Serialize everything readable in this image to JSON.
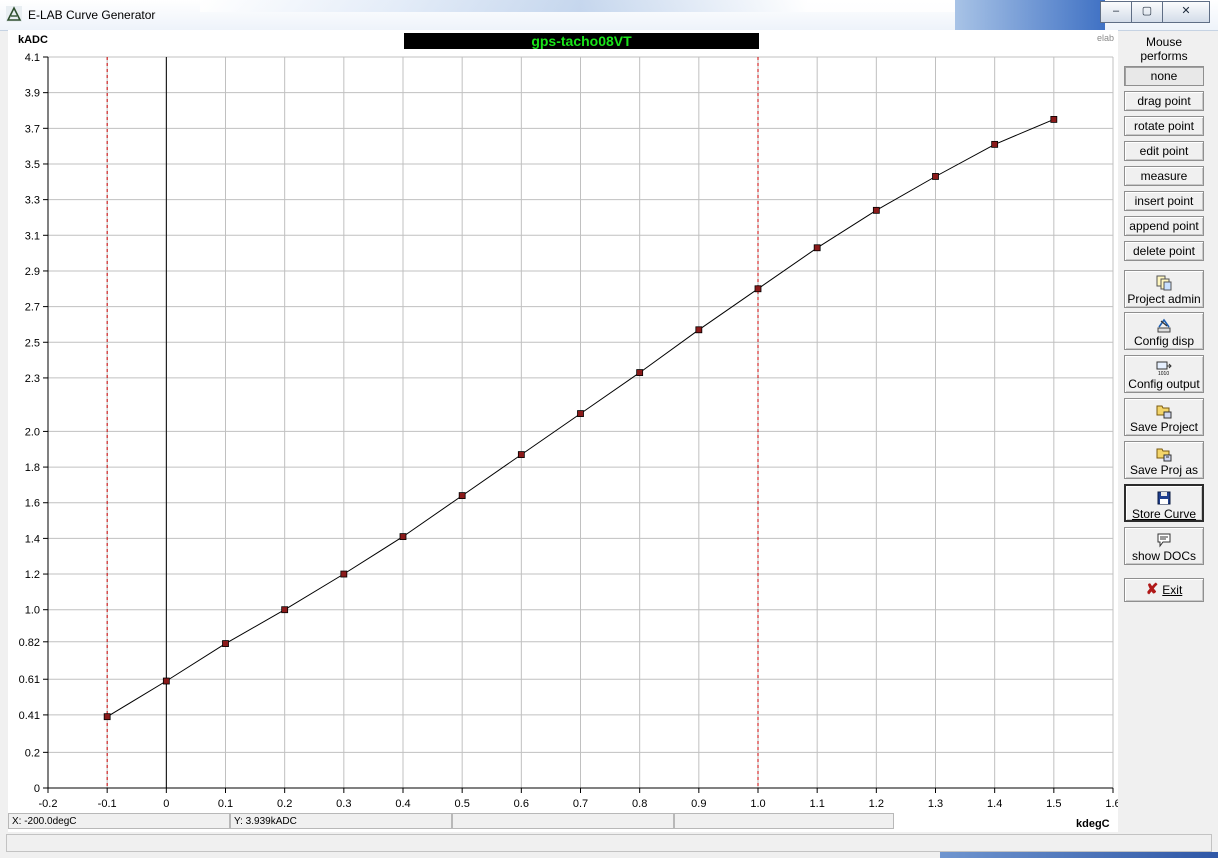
{
  "window": {
    "title": "E-LAB Curve Generator",
    "controls": {
      "minimize": "–",
      "maximize": "▢",
      "close": "✕"
    }
  },
  "plot": {
    "curve_name": "gps-tacho08VT",
    "watermark": "elab",
    "y_unit": "kADC",
    "x_unit": "kdegC",
    "x_ticks": [
      "-0.2",
      "-0.1",
      "0",
      "0.1",
      "0.2",
      "0.3",
      "0.4",
      "0.5",
      "0.6",
      "0.7",
      "0.8",
      "0.9",
      "1.0",
      "1.1",
      "1.2",
      "1.3",
      "1.4",
      "1.5",
      "1.6"
    ],
    "y_ticks": [
      "0",
      "0.2",
      "0.41",
      "0.61",
      "0.82",
      "1.0",
      "1.2",
      "1.4",
      "1.6",
      "1.8",
      "2.0",
      "2.3",
      "2.5",
      "2.7",
      "2.9",
      "3.1",
      "3.3",
      "3.5",
      "3.7",
      "3.9",
      "4.1"
    ],
    "x_range": [
      -0.2,
      1.6
    ],
    "y_range": [
      0,
      4.1
    ],
    "red_marker_x": [
      -0.1,
      1.0
    ],
    "zero_line_x": 0,
    "points": [
      [
        -0.1,
        0.4
      ],
      [
        0,
        0.6
      ],
      [
        0.1,
        0.81
      ],
      [
        0.2,
        1.0
      ],
      [
        0.3,
        1.2
      ],
      [
        0.4,
        1.41
      ],
      [
        0.5,
        1.64
      ],
      [
        0.6,
        1.87
      ],
      [
        0.7,
        2.1
      ],
      [
        0.8,
        2.33
      ],
      [
        0.9,
        2.57
      ],
      [
        1.0,
        2.8
      ],
      [
        1.1,
        3.03
      ],
      [
        1.2,
        3.24
      ],
      [
        1.3,
        3.43
      ],
      [
        1.4,
        3.61
      ],
      [
        1.5,
        3.75
      ]
    ],
    "colors": {
      "curve": "#000000",
      "marker_fill": "#8b1a1a",
      "red_line": "#cc0000",
      "grid": "#c0c0c0",
      "title_bg": "#000000",
      "title_fg": "#19e419"
    }
  },
  "status": {
    "x": "X: -200.0degC",
    "y": "Y: 3.939kADC",
    "field3": "",
    "field4": ""
  },
  "sidebar": {
    "mouse_label_1": "Mouse",
    "mouse_label_2": "performs",
    "mode_buttons": [
      "none",
      "drag point",
      "rotate point",
      "edit point",
      "measure",
      "insert point",
      "append point",
      "delete point"
    ],
    "actions": {
      "project_admin": "Project admin",
      "config_disp": "Config disp",
      "config_output": "Config output",
      "save_project": "Save Project",
      "save_proj_as": "Save Proj as",
      "store_curve": "Store Curve",
      "show_docs": "show DOCs",
      "exit": "Exit"
    }
  }
}
